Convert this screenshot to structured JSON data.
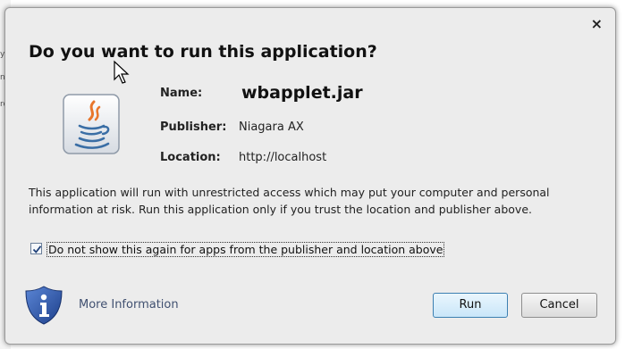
{
  "background": {
    "fragments": [
      "y",
      "n",
      "ro"
    ]
  },
  "dialog": {
    "close_glyph": "×",
    "title": "Do you want to run this application?",
    "fields": {
      "name_label": "Name:",
      "name_value": "wbapplet.jar",
      "publisher_label": "Publisher:",
      "publisher_value": "Niagara AX",
      "location_label": "Location:",
      "location_value": "http://localhost"
    },
    "warning_text": "This application will run with unrestricted access which may put your computer and personal information at risk. Run this application only if you trust the location and publisher above.",
    "checkbox": {
      "label": "Do not show this again for apps from the publisher and location above",
      "checked": true
    },
    "more_info_label": "More Information",
    "buttons": {
      "run": "Run",
      "cancel": "Cancel"
    },
    "colors": {
      "accent": "#3c7fb1",
      "shield": "#2a57a8",
      "link": "#405070"
    },
    "icons": [
      "java-cup-icon",
      "info-shield-icon",
      "mouse-pointer-icon",
      "close-icon",
      "checkmark-icon"
    ]
  }
}
